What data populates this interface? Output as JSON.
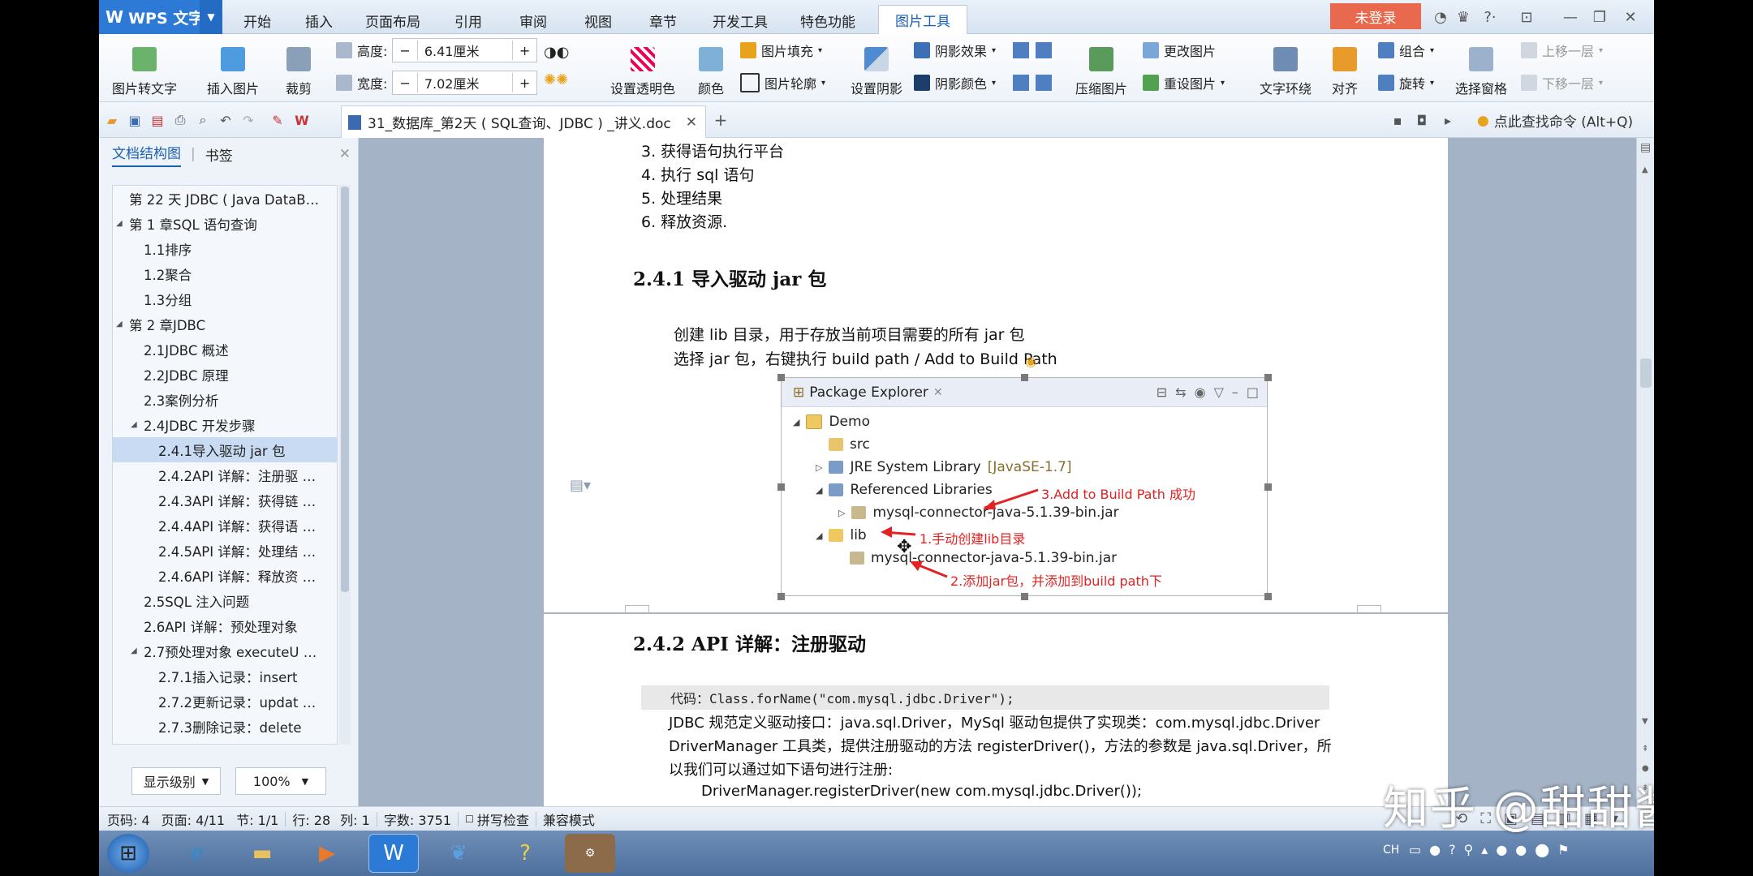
{
  "app": {
    "name": "WPS 文字",
    "login": "未登录"
  },
  "tabs": [
    "开始",
    "插入",
    "页面布局",
    "引用",
    "审阅",
    "视图",
    "章节",
    "开发工具",
    "特色功能",
    "图片工具"
  ],
  "ribbon": {
    "pic_to_text": "图片转文字",
    "insert_pic": "插入图片",
    "crop": "裁剪",
    "height_label": "高度:",
    "height_value": "6.41厘米",
    "width_label": "宽度:",
    "width_value": "7.02厘米",
    "set_transparent": "设置透明色",
    "color": "颜色",
    "pic_fill": "图片填充",
    "pic_outline": "图片轮廓",
    "set_shadow": "设置阴影",
    "shadow_effect": "阴影效果",
    "shadow_color": "阴影颜色",
    "compress": "压缩图片",
    "change_pic": "更改图片",
    "reset_pic": "重设图片",
    "text_wrap": "文字环绕",
    "align": "对齐",
    "group": "组合",
    "rotate": "旋转",
    "select_pane": "选择窗格",
    "bring_forward": "上移一层",
    "send_backward": "下移一层"
  },
  "document_tab": "31_数据库_第2天 ( SQL查询、JDBC ) _讲义.doc",
  "find_command": "点此查找命令 (Alt+Q)",
  "nav": {
    "tab_outline": "文档结构图",
    "tab_bookmark": "书签",
    "items": [
      {
        "text": "第 22 天 JDBC ( Java DataB…",
        "level": 0,
        "arrow": ""
      },
      {
        "text": "第 1 章SQL 语句查询",
        "level": 0,
        "arrow": "◢"
      },
      {
        "text": "1.1排序",
        "level": 1,
        "arrow": ""
      },
      {
        "text": "1.2聚合",
        "level": 1,
        "arrow": ""
      },
      {
        "text": "1.3分组",
        "level": 1,
        "arrow": ""
      },
      {
        "text": "第 2 章JDBC",
        "level": 0,
        "arrow": "◢"
      },
      {
        "text": "2.1JDBC 概述",
        "level": 1,
        "arrow": ""
      },
      {
        "text": "2.2JDBC 原理",
        "level": 1,
        "arrow": ""
      },
      {
        "text": "2.3案例分析",
        "level": 1,
        "arrow": ""
      },
      {
        "text": "2.4JDBC 开发步骤",
        "level": 1,
        "arrow": "◢"
      },
      {
        "text": "2.4.1导入驱动 jar 包",
        "level": 2,
        "arrow": "",
        "selected": true
      },
      {
        "text": "2.4.2API 详解：注册驱 …",
        "level": 2,
        "arrow": ""
      },
      {
        "text": "2.4.3API 详解：获得链 …",
        "level": 2,
        "arrow": ""
      },
      {
        "text": "2.4.4API 详解：获得语 …",
        "level": 2,
        "arrow": ""
      },
      {
        "text": "2.4.5API 详解：处理结 …",
        "level": 2,
        "arrow": ""
      },
      {
        "text": "2.4.6API 详解：释放资 …",
        "level": 2,
        "arrow": ""
      },
      {
        "text": "2.5SQL 注入问题",
        "level": 1,
        "arrow": ""
      },
      {
        "text": "2.6API 详解：预处理对象",
        "level": 1,
        "arrow": ""
      },
      {
        "text": "2.7预处理对象 executeU …",
        "level": 1,
        "arrow": "◢"
      },
      {
        "text": "2.7.1插入记录：insert",
        "level": 2,
        "arrow": ""
      },
      {
        "text": "2.7.2更新记录：updat …",
        "level": 2,
        "arrow": ""
      },
      {
        "text": "2.7.3删除记录：delete",
        "level": 2,
        "arrow": ""
      }
    ],
    "level_button": "显示级别",
    "zoom": "100%"
  },
  "page1": {
    "steps": [
      "3.   获得语句执行平台",
      "4.   执行 sql 语句",
      "5.   处理结果",
      "6.   释放资源."
    ],
    "heading": "2.4.1  导入驱动 jar 包",
    "para1": "创建 lib 目录，用于存放当前项目需要的所有 jar 包",
    "para2": "选择 jar 包，右键执行 build path / Add to Build Path"
  },
  "package_explorer": {
    "title": "Package Explorer",
    "rows": [
      {
        "text": "Demo",
        "suffix": ""
      },
      {
        "text": "src",
        "suffix": ""
      },
      {
        "text": "JRE System Library",
        "suffix": "[JavaSE-1.7]"
      },
      {
        "text": "Referenced Libraries",
        "suffix": ""
      },
      {
        "text": "mysql-connector-java-5.1.39-bin.jar",
        "suffix": ""
      },
      {
        "text": "lib",
        "suffix": ""
      },
      {
        "text": "mysql-connector-java-5.1.39-bin.jar",
        "suffix": ""
      }
    ],
    "annotations": [
      "3.Add to Build Path 成功",
      "1.手动创建lib目录",
      "2.添加jar包，并添加到build path下"
    ]
  },
  "page2": {
    "heading": "2.4.2  API 详解：注册驱动",
    "code": "代码：Class.forName(\"com.mysql.jdbc.Driver\");",
    "line1": "JDBC 规范定义驱动接口：java.sql.Driver，MySql 驱动包提供了实现类：com.mysql.jdbc.Driver",
    "line2": "DriverManager 工具类，提供注册驱动的方法 registerDriver()，方法的参数是 java.sql.Driver，所",
    "line3": "以我们可以通过如下语句进行注册:",
    "line4": "DriverManager.registerDriver(new com.mysql.jdbc.Driver());"
  },
  "status": {
    "page_no": "页码: 4",
    "pages": "页面: 4/11",
    "section": "节: 1/1",
    "row": "行: 28",
    "col": "列: 1",
    "words": "字数: 3751",
    "spell": "拼写检查",
    "compat": "兼容模式"
  },
  "taskbar": {
    "tray_lang": "CH"
  },
  "watermark": "知乎 @甜甜酱",
  "colors": {
    "accent": "#2d7ad6",
    "login": "#e8694e",
    "annotation": "#e32222",
    "selected": "#c9dbf2"
  }
}
